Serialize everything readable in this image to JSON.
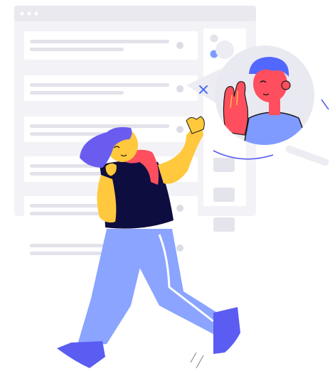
{
  "illustration": {
    "subject": "person-walking-with-video-call-bubble",
    "colors": {
      "window_frame": "#f1f1f5",
      "window_titlebar": "#e8e8ee",
      "window_dots": "#ffffff",
      "card": "#ffffff",
      "card_line": "#e2e2ea",
      "card_bullet": "#dcdce4",
      "sidebar_pill": "#e4e4ec",
      "avatar_blue": "#7b9bff",
      "bubble_bg": "#e9e9f1",
      "accent_blue": "#4f6bf5",
      "skin_yellow": "#ffc83d",
      "skin_red": "#ff4f5e",
      "hair_purple": "#6b5cf0",
      "shirt_navy": "#0e0d3f",
      "pants_blue": "#8aa4ff",
      "shoe_blue": "#5b5cf2",
      "caller_shirt": "#7f9bff",
      "caller_skin": "#ff4f5e",
      "caller_hair": "#5167ff",
      "outline": "#1a1a1a"
    },
    "icons": [
      "window-dots-icon",
      "close-x-icon",
      "waving-hand-icon"
    ]
  }
}
